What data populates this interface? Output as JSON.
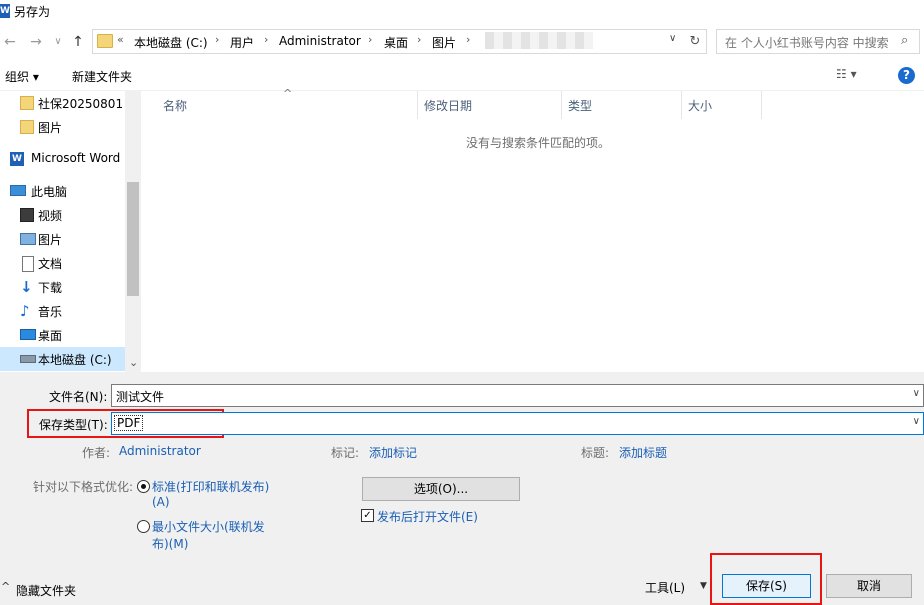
{
  "window": {
    "title": "另存为",
    "icon_letter": "W"
  },
  "nav": {
    "back_icon": "←",
    "forward_icon": "→",
    "history_icon": "∨",
    "up_icon": "↑",
    "breadcrumb": [
      "«",
      "本地磁盘 (C:)",
      "用户",
      "Administrator",
      "桌面",
      "图片"
    ],
    "separator": "›",
    "address_dropdown_icon": "∨",
    "refresh_icon": "↻",
    "search_placeholder": "在 个人小红书账号内容 中搜索",
    "search_icon": "⌕"
  },
  "toolbar": {
    "organize": "组织 ▾",
    "new_folder": "新建文件夹",
    "view_icon": "☷ ▾",
    "help": "?"
  },
  "sidebar": {
    "items": [
      {
        "label": "社保20250801",
        "icon": "folder-icon"
      },
      {
        "label": "图片",
        "icon": "folder-icon"
      },
      {
        "label": "Microsoft Word",
        "icon": "word-icon"
      },
      {
        "label": "此电脑",
        "icon": "computer-icon"
      },
      {
        "label": "视频",
        "icon": "video-icon"
      },
      {
        "label": "图片",
        "icon": "pictures-icon"
      },
      {
        "label": "文档",
        "icon": "documents-icon"
      },
      {
        "label": "下载",
        "icon": "download-icon"
      },
      {
        "label": "音乐",
        "icon": "music-icon"
      },
      {
        "label": "桌面",
        "icon": "desktop-icon"
      },
      {
        "label": "本地磁盘 (C:)",
        "icon": "drive-icon"
      }
    ],
    "scroll_down_icon": "⌄"
  },
  "filelist": {
    "columns": [
      "名称",
      "修改日期",
      "类型",
      "大小"
    ],
    "sort_icon": "^",
    "empty_message": "没有与搜索条件匹配的项。"
  },
  "form": {
    "filename_label": "文件名(N):",
    "filename_value": "测试文件",
    "type_label": "保存类型(T):",
    "type_value": "PDF",
    "dropdown_icon": "∨",
    "author_label": "作者:",
    "author_value": "Administrator",
    "tags_label": "标记:",
    "tags_value": "添加标记",
    "title_label": "标题:",
    "title_value": "添加标题",
    "optimize_label": "针对以下格式优化:",
    "radio_standard_line1": "标准(打印和联机发布)",
    "radio_standard_line2": "(A)",
    "radio_min_line1": "最小文件大小(联机发",
    "radio_min_line2": "布)(M)",
    "optimize_selected": "standard",
    "options_button": "选项(O)...",
    "open_after_publish": "发布后打开文件(E)",
    "open_after_publish_checked": true
  },
  "footer": {
    "hide_folders": "隐藏文件夹",
    "hide_icon": "^",
    "tools": "工具(L)",
    "tools_icon": "▼",
    "save": "保存(S)",
    "cancel": "取消"
  },
  "colors": {
    "highlight_red": "#e81515",
    "link_blue": "#1a5fb4",
    "selection": "#cce8ff"
  }
}
